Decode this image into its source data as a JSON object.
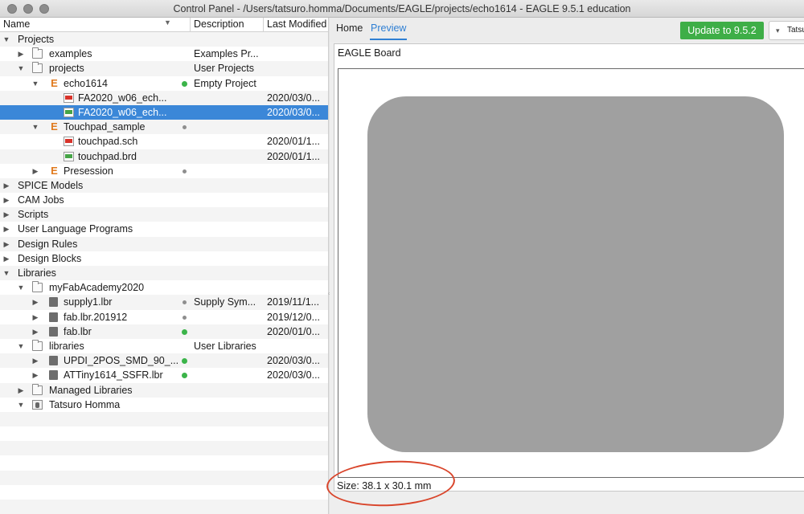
{
  "window": {
    "title": "Control Panel - /Users/tatsuro.homma/Documents/EAGLE/projects/echo1614 - EAGLE 9.5.1 education"
  },
  "tree": {
    "headers": {
      "name": "Name",
      "description": "Description",
      "last_modified": "Last Modified"
    },
    "rows": [
      {
        "label": "Projects",
        "icon": "none",
        "arrow": "down",
        "level": 0
      },
      {
        "label": "examples",
        "icon": "folder-icon",
        "arrow": "right",
        "level": 1,
        "desc": "Examples Pr..."
      },
      {
        "label": "projects",
        "icon": "folder-icon",
        "arrow": "down",
        "level": 1,
        "desc": "User Projects"
      },
      {
        "label": "echo1614",
        "icon": "eagle-project-icon",
        "arrow": "down",
        "level": 2,
        "dot": "green",
        "desc": "Empty Project"
      },
      {
        "label": "FA2020_w06_ech...",
        "icon": "schematic-icon",
        "arrow": "none",
        "level": 3,
        "date": "2020/03/0..."
      },
      {
        "label": "FA2020_w06_ech...",
        "icon": "board-icon",
        "arrow": "none",
        "level": 3,
        "date": "2020/03/0...",
        "selected": true
      },
      {
        "label": "Touchpad_sample",
        "icon": "eagle-project-icon",
        "arrow": "down",
        "level": 2,
        "dot": "gray"
      },
      {
        "label": "touchpad.sch",
        "icon": "schematic-icon",
        "arrow": "none",
        "level": 3,
        "date": "2020/01/1..."
      },
      {
        "label": "touchpad.brd",
        "icon": "board-icon",
        "arrow": "none",
        "level": 3,
        "date": "2020/01/1..."
      },
      {
        "label": "Presession",
        "icon": "eagle-project-icon",
        "arrow": "right",
        "level": 2,
        "dot": "gray"
      },
      {
        "label": "SPICE Models",
        "icon": "none",
        "arrow": "right",
        "level": 0
      },
      {
        "label": "CAM Jobs",
        "icon": "none",
        "arrow": "right",
        "level": 0
      },
      {
        "label": "Scripts",
        "icon": "none",
        "arrow": "right",
        "level": 0
      },
      {
        "label": "User Language Programs",
        "icon": "none",
        "arrow": "right",
        "level": 0
      },
      {
        "label": "Design Rules",
        "icon": "none",
        "arrow": "right",
        "level": 0
      },
      {
        "label": "Design Blocks",
        "icon": "none",
        "arrow": "right",
        "level": 0
      },
      {
        "label": "Libraries",
        "icon": "none",
        "arrow": "down",
        "level": 0
      },
      {
        "label": "myFabAcademy2020",
        "icon": "folder-icon",
        "arrow": "down",
        "level": 1
      },
      {
        "label": "supply1.lbr",
        "icon": "library-icon",
        "arrow": "right",
        "level": 2,
        "dot": "gray",
        "desc": "Supply Sym...",
        "date": "2019/11/1..."
      },
      {
        "label": "fab.lbr.201912",
        "icon": "library-icon",
        "arrow": "right",
        "level": 2,
        "dot": "gray",
        "date": "2019/12/0..."
      },
      {
        "label": "fab.lbr",
        "icon": "library-icon",
        "arrow": "right",
        "level": 2,
        "dot": "green",
        "date": "2020/01/0..."
      },
      {
        "label": "libraries",
        "icon": "folder-icon",
        "arrow": "down",
        "level": 1,
        "desc": "User Libraries"
      },
      {
        "label": "UPDI_2POS_SMD_90_...",
        "icon": "library-icon",
        "arrow": "right",
        "level": 2,
        "dot": "green",
        "date": "2020/03/0..."
      },
      {
        "label": "ATTiny1614_SSFR.lbr",
        "icon": "library-icon",
        "arrow": "right",
        "level": 2,
        "dot": "green",
        "date": "2020/03/0..."
      },
      {
        "label": "Managed Libraries",
        "icon": "folder-icon",
        "arrow": "right",
        "level": 1
      },
      {
        "label": "Tatsuro Homma",
        "icon": "user-icon",
        "arrow": "down",
        "level": 1
      }
    ]
  },
  "right": {
    "tabs": [
      "Home",
      "Preview"
    ],
    "active_tab": "Preview",
    "update_button": "Update to 9.5.2",
    "user_button": "Tatsu",
    "preview_title": "EAGLE Board",
    "size_text": "Size: 38.1 x 30.1 mm"
  },
  "colors": {
    "accent": "#2f7fd3",
    "selected_row": "#3b87d8",
    "update_button": "#3eae47",
    "board": "#a0a0a0",
    "annotation_circle": "#d9452b"
  }
}
